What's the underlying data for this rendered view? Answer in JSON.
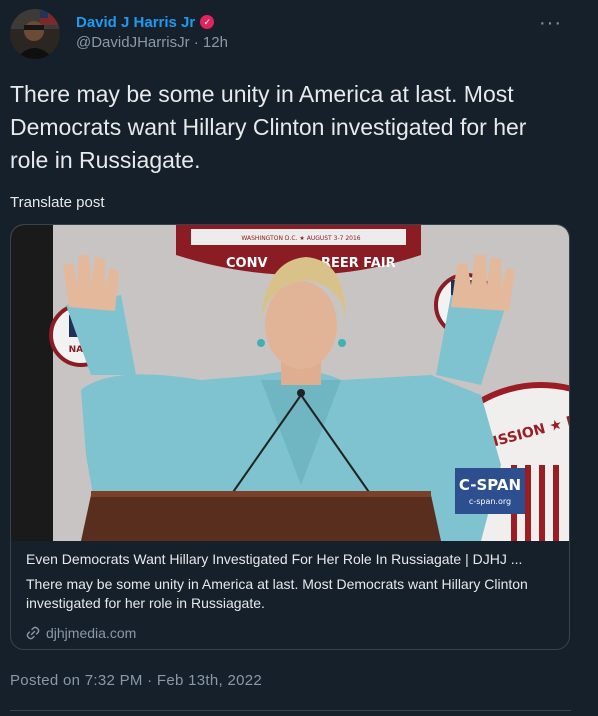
{
  "author": {
    "name": "David J Harris Jr",
    "handle": "@DavidJHarrisJr",
    "separator": "·",
    "time_ago": "12h",
    "verified_icon": "verified-badge-icon",
    "verified_color": "#e0245e"
  },
  "post": {
    "text": "There may be some unity in America at last. Most Democrats want Hillary Clinton investigated for her role in Russiagate.",
    "translate_label": "Translate post",
    "more_icon": "more-horizontal-icon"
  },
  "link_card": {
    "title": "Even Democrats Want Hillary Investigated For Her Role In Russiagate | DJHJ ...",
    "description": "There may be some unity in America at last. Most Democrats want Hillary Clinton investigated for her role in Russiagate.",
    "domain": "djhjmedia.com",
    "domain_icon": "link-icon",
    "image_overlay": {
      "logo_text": "C-SPAN",
      "logo_subtext": "c-span.org",
      "banner_text": "CONV",
      "banner_text_2": "REER FAIR",
      "banner_small": "WASHINGTON D.C. ★ AUGUST 3-7 2016",
      "side_text": "NABJ",
      "commission_text": "MISSION ★ DRIV"
    }
  },
  "footer": {
    "posted_label": "Posted on 7:32 PM · Feb 13th, 2022"
  },
  "colors": {
    "background": "#15202b",
    "accent": "#1d9bf0",
    "muted": "#8b98a5",
    "border": "#38444d"
  }
}
